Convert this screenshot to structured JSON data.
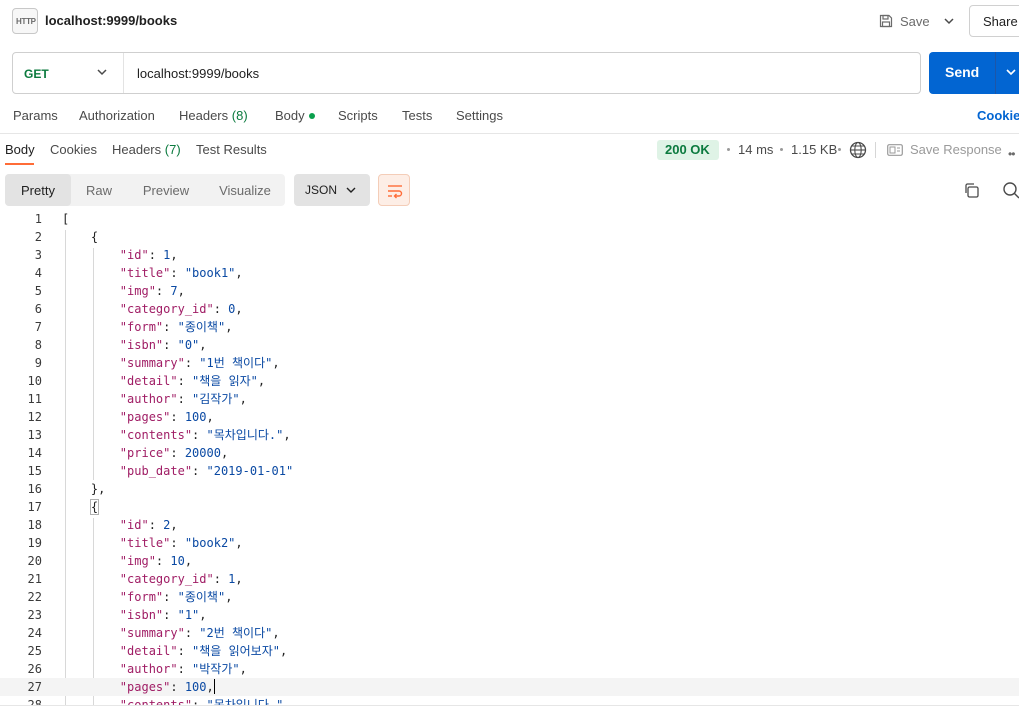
{
  "window": {
    "tab_title": "localhost:9999/books",
    "http_icon_text": "HTTP",
    "save_label": "Save",
    "share_label": "Share"
  },
  "request": {
    "method": "GET",
    "url": "localhost:9999/books",
    "send_label": "Send",
    "tabs": [
      {
        "label": "Params"
      },
      {
        "label": "Authorization"
      },
      {
        "label": "Headers",
        "count": "(8)"
      },
      {
        "label": "Body"
      },
      {
        "label": "Scripts"
      },
      {
        "label": "Tests"
      },
      {
        "label": "Settings"
      }
    ],
    "cookies_label": "Cookies"
  },
  "response": {
    "tabs": [
      {
        "label": "Body"
      },
      {
        "label": "Cookies"
      },
      {
        "label": "Headers",
        "count": "(7)"
      },
      {
        "label": "Test Results"
      }
    ],
    "status": "200 OK",
    "time": "14 ms",
    "size": "1.15 KB",
    "save_response_label": "Save Response",
    "more_icon": "••",
    "views": [
      "Pretty",
      "Raw",
      "Preview",
      "Visualize"
    ],
    "format": "JSON",
    "colors": {
      "accent": "#ff6c37",
      "send": "#0265d2",
      "ok": "#0b7a3e"
    }
  },
  "code_lines": [
    {
      "n": "1",
      "text": "["
    },
    {
      "n": "2",
      "text": "    {"
    },
    {
      "n": "3",
      "key": "id",
      "val": "1",
      "type": "num",
      "comma": ","
    },
    {
      "n": "4",
      "key": "title",
      "val": "\"book1\"",
      "type": "str",
      "comma": ","
    },
    {
      "n": "5",
      "key": "img",
      "val": "7",
      "type": "num",
      "comma": ","
    },
    {
      "n": "6",
      "key": "category_id",
      "val": "0",
      "type": "num",
      "comma": ","
    },
    {
      "n": "7",
      "key": "form",
      "val": "\"종이책\"",
      "type": "str",
      "comma": ","
    },
    {
      "n": "8",
      "key": "isbn",
      "val": "\"0\"",
      "type": "str",
      "comma": ","
    },
    {
      "n": "9",
      "key": "summary",
      "val": "\"1번 책이다\"",
      "type": "str",
      "comma": ","
    },
    {
      "n": "10",
      "key": "detail",
      "val": "\"책을 읽자\"",
      "type": "str",
      "comma": ","
    },
    {
      "n": "11",
      "key": "author",
      "val": "\"김작가\"",
      "type": "str",
      "comma": ","
    },
    {
      "n": "12",
      "key": "pages",
      "val": "100",
      "type": "num",
      "comma": ","
    },
    {
      "n": "13",
      "key": "contents",
      "val": "\"목차입니다.\"",
      "type": "str",
      "comma": ","
    },
    {
      "n": "14",
      "key": "price",
      "val": "20000",
      "type": "num",
      "comma": ","
    },
    {
      "n": "15",
      "key": "pub_date",
      "val": "\"2019-01-01\"",
      "type": "str",
      "comma": ""
    },
    {
      "n": "16",
      "text": "    },"
    },
    {
      "n": "17",
      "text": "    {"
    },
    {
      "n": "18",
      "key": "id",
      "val": "2",
      "type": "num",
      "comma": ","
    },
    {
      "n": "19",
      "key": "title",
      "val": "\"book2\"",
      "type": "str",
      "comma": ","
    },
    {
      "n": "20",
      "key": "img",
      "val": "10",
      "type": "num",
      "comma": ","
    },
    {
      "n": "21",
      "key": "category_id",
      "val": "1",
      "type": "num",
      "comma": ","
    },
    {
      "n": "22",
      "key": "form",
      "val": "\"종이책\"",
      "type": "str",
      "comma": ","
    },
    {
      "n": "23",
      "key": "isbn",
      "val": "\"1\"",
      "type": "str",
      "comma": ","
    },
    {
      "n": "24",
      "key": "summary",
      "val": "\"2번 책이다\"",
      "type": "str",
      "comma": ","
    },
    {
      "n": "25",
      "key": "detail",
      "val": "\"책을 읽어보자\"",
      "type": "str",
      "comma": ","
    },
    {
      "n": "26",
      "key": "author",
      "val": "\"박작가\"",
      "type": "str",
      "comma": ","
    },
    {
      "n": "27",
      "key": "pages",
      "val": "100",
      "type": "num",
      "comma": ","
    },
    {
      "n": "28",
      "key": "contents",
      "val": "\"목차입니다.\"",
      "type": "str",
      "comma": ","
    }
  ]
}
